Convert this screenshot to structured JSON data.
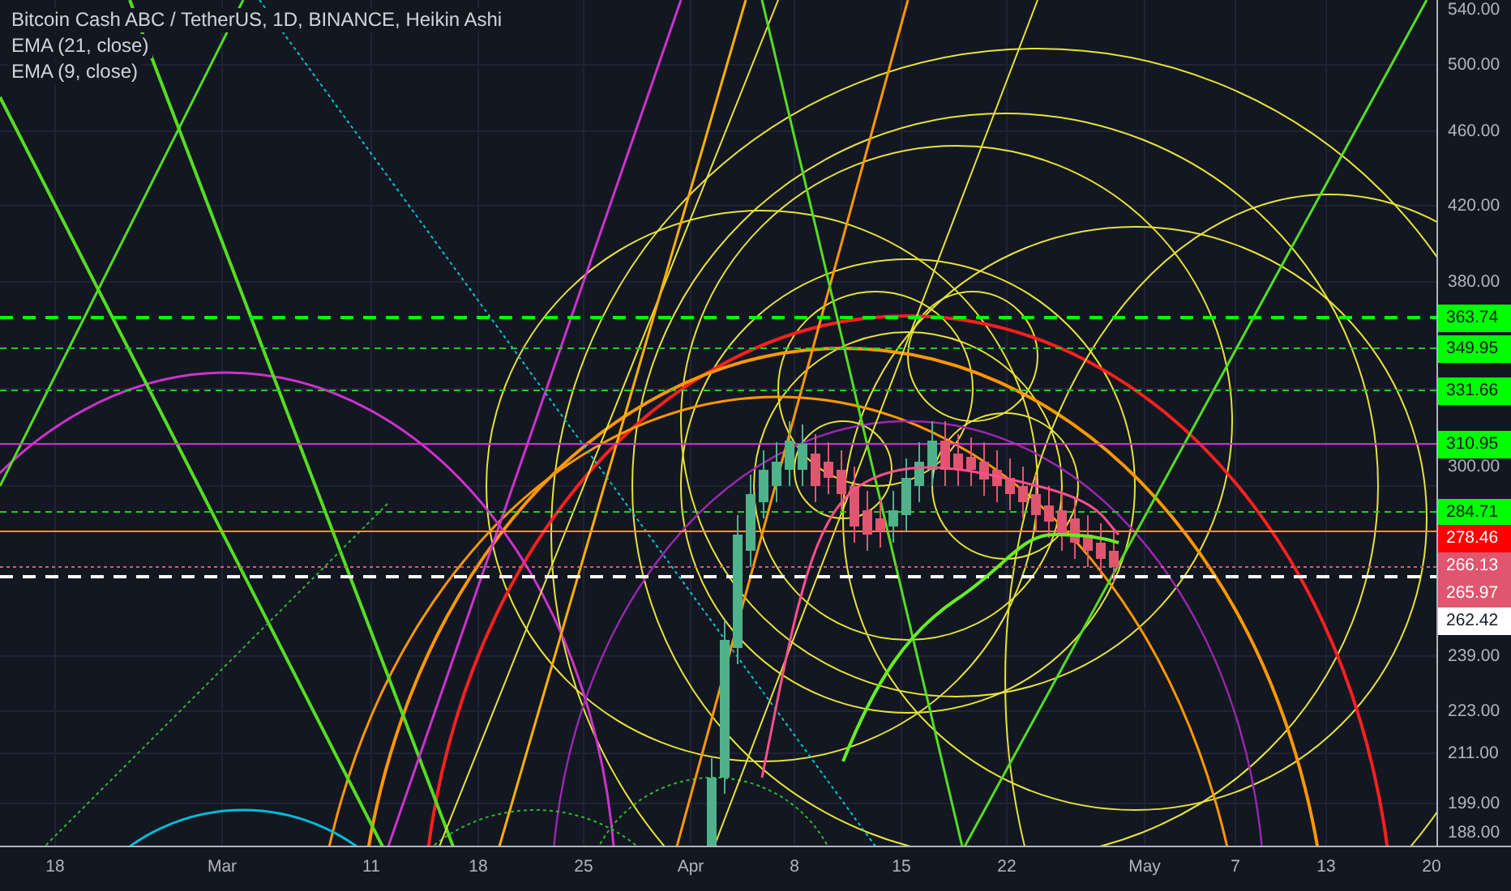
{
  "chart": {
    "title": "Bitcoin Cash ABC / TetherUS, 1D, BINANCE, Heikin Ashi",
    "indicators": [
      "EMA (21, close)",
      "EMA (9, close)"
    ]
  },
  "price_axis": {
    "ticks": [
      "540.00",
      "500.00",
      "460.00",
      "420.00",
      "380.00",
      "300.00",
      "239.00",
      "223.00",
      "211.00",
      "199.00",
      "188.00"
    ],
    "tags": [
      {
        "label": "363.74",
        "color": "#00ff00"
      },
      {
        "label": "349.95",
        "color": "#00ff00"
      },
      {
        "label": "331.66",
        "color": "#00ff00"
      },
      {
        "label": "310.95",
        "color": "#00ff00"
      },
      {
        "label": "284.71",
        "color": "#00ff00"
      },
      {
        "label": "278.46",
        "color": "#ff0000"
      },
      {
        "label": "266.13",
        "color": "#e0566f"
      },
      {
        "label": "265.97",
        "color": "#e0566f"
      },
      {
        "label": "262.42",
        "color": "#ffffff"
      }
    ]
  },
  "time_axis": {
    "labels": [
      "18",
      "Mar",
      "11",
      "18",
      "25",
      "Apr",
      "8",
      "15",
      "22",
      "May",
      "7",
      "13",
      "20"
    ]
  }
}
